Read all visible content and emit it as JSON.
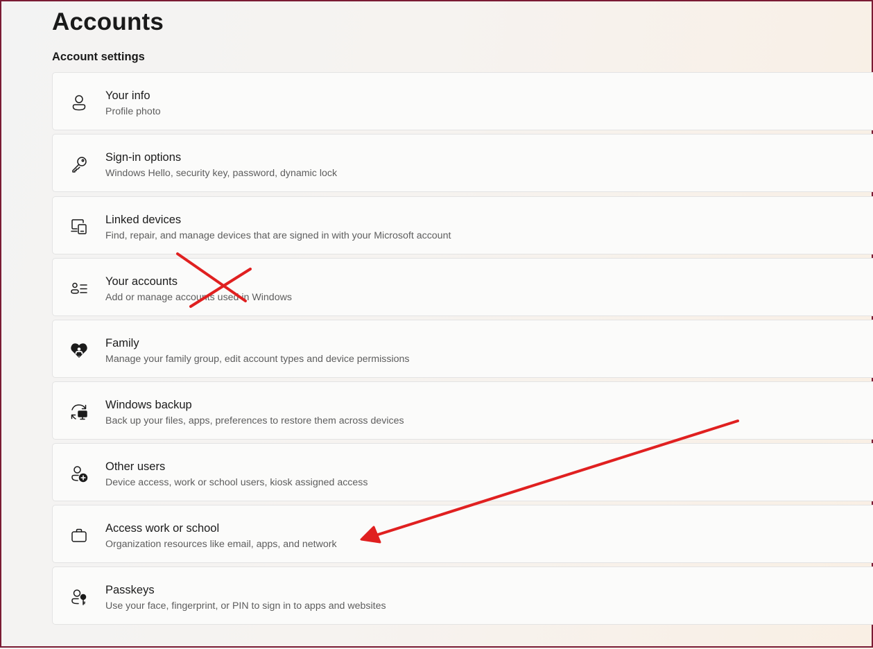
{
  "page": {
    "title": "Accounts",
    "section_title": "Account settings"
  },
  "settings": [
    {
      "label": "Your info",
      "description": "Profile photo",
      "icon": "person-icon"
    },
    {
      "label": "Sign-in options",
      "description": "Windows Hello, security key, password, dynamic lock",
      "icon": "key-icon"
    },
    {
      "label": "Linked devices",
      "description": "Find, repair, and manage devices that are signed in with your Microsoft account",
      "icon": "linked-devices-icon"
    },
    {
      "label": "Your accounts",
      "description": "Add or manage accounts used in Windows",
      "icon": "accounts-list-icon"
    },
    {
      "label": "Family",
      "description": "Manage your family group, edit account types and device permissions",
      "icon": "family-heart-icon"
    },
    {
      "label": "Windows backup",
      "description": "Back up your files, apps, preferences to restore them across devices",
      "icon": "backup-sync-icon"
    },
    {
      "label": "Other users",
      "description": "Device access, work or school users, kiosk assigned access",
      "icon": "add-person-icon"
    },
    {
      "label": "Access work or school",
      "description": "Organization resources like email, apps, and network",
      "icon": "briefcase-icon"
    },
    {
      "label": "Passkeys",
      "description": "Use your face, fingerprint, or PIN to sign in to apps and websites",
      "icon": "passkey-icon"
    }
  ],
  "annotations": {
    "color": "#e02020",
    "cross_mark_target": "Your accounts",
    "arrow_target": "Access work or school"
  },
  "colors": {
    "frame_border": "#7a1b34",
    "card_background": "#fbfbfa",
    "card_border": "#e3e3e3"
  }
}
